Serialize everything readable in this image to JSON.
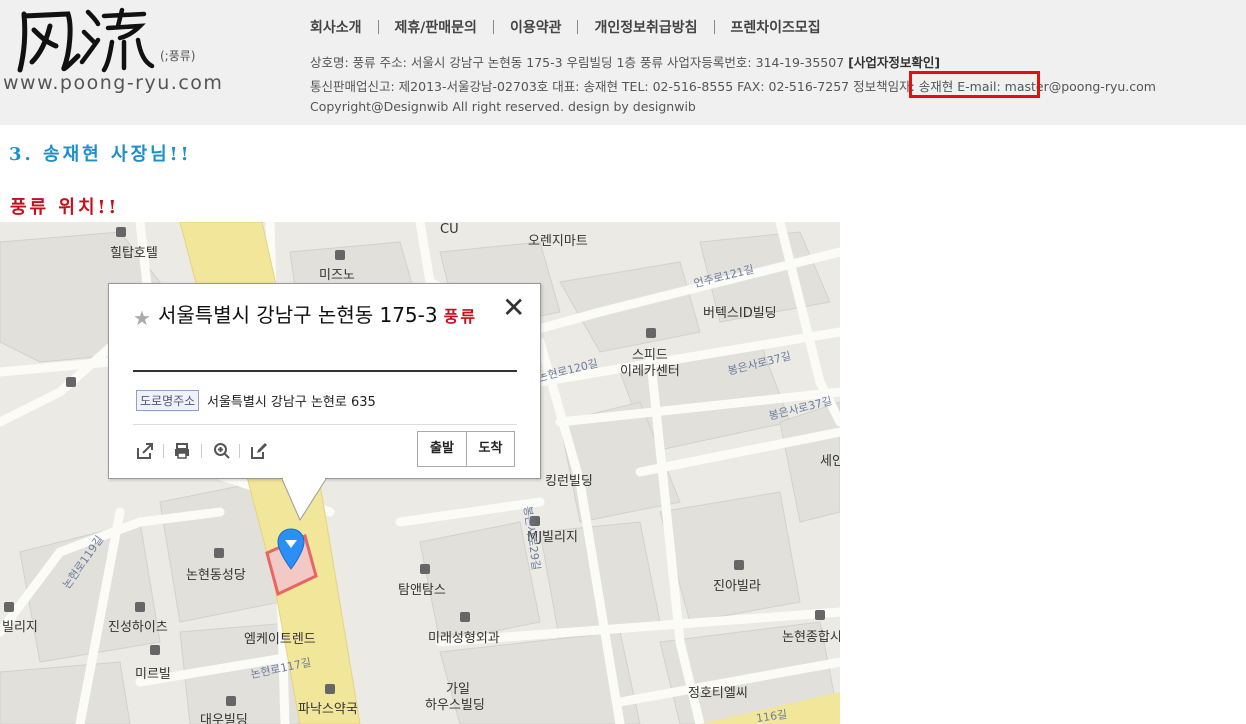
{
  "header": {
    "logo_calligraphy": "風流",
    "logo_tag": "(;풍류)",
    "logo_url": "www.poong-ryu.com",
    "nav": [
      "회사소개",
      "제휴/판매문의",
      "이용약관",
      "개인정보취급방침",
      "프렌차이즈모집"
    ],
    "info1_text": "상호명: 풍류  주소: 서울시 강남구 논현동 175-3 우림빌딩 1층 풍류  사업자등록번호: 314-19-35507",
    "info1_biz_link": "[사업자정보확인]",
    "info2_pre": "통신판매업신고: 제2013-서울강남-02703호  대표: 송재현  TEL: 02-516-8555  FAX: 02-516-7257",
    "info2_highlight": "정보책임자: 송재현",
    "info2_email": "E-mail: master@poong-ryu.com",
    "copyright": "Copyright@Designwib All right reserved. design by designwib",
    "highlight_color": "#e11111"
  },
  "section_owner_title": "3. 송재현 사장님!!",
  "section_location_title": "풍류 위치!!",
  "map": {
    "labels": {
      "hilltop": "힐탑호텔",
      "cu": "CU",
      "orange": "오렌지마트",
      "mizuno": "미즈노",
      "vertex": "버텍스ID빌딩",
      "speed1": "스피드",
      "speed2": "이레카센터",
      "sein": "세인",
      "king": "킹런빌딩",
      "mj": "MJ빌리지",
      "nhs": "논현동성당",
      "tam": "탐앤탐스",
      "jina": "진아빌라",
      "nhjh": "논현종합시",
      "bilji": "빌리지",
      "jinsung": "진성하이츠",
      "mireu": "미르빌",
      "mcate": "엠케이트렌드",
      "mirae": "미래성형외과",
      "gayil1": "가일",
      "gayil2": "하우스빌딩",
      "jungho": "정호티엘씨",
      "panax": "파낙스약국",
      "daewoo": "대우빌딩",
      "bongeunsa": "봉은사로37길",
      "bongeunsa2": "봉은사로37길",
      "eonju121": "언주로121길",
      "nh120": "논현로120길",
      "nh119": "논현로119길",
      "nh117": "논현로117길",
      "bongeun29": "봉은사로29길",
      "r116": "116길"
    },
    "popup": {
      "title": "서울특별시 강남구 논현동 175-3",
      "name": "풍류",
      "badge": "도로명주소",
      "road_address": "서울특별시 강남구 논현로 635",
      "btn_depart": "출발",
      "btn_arrive": "도착",
      "close_glyph": "✕",
      "star_glyph": "★"
    }
  }
}
